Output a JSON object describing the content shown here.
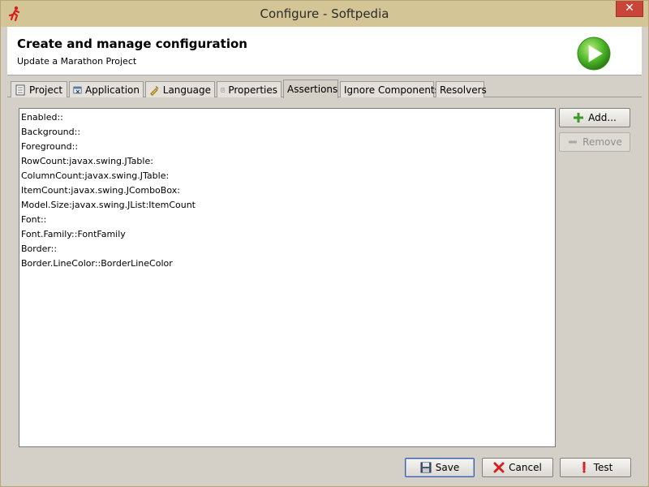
{
  "window": {
    "title": "Configure - Softpedia",
    "close_glyph": "✕"
  },
  "header": {
    "title": "Create and manage configuration",
    "subtitle": "Update a Marathon Project",
    "icon": "green-play-icon"
  },
  "tabs": [
    {
      "label": "Project",
      "icon": "project-icon",
      "active": false
    },
    {
      "label": "Application",
      "icon": "application-icon",
      "active": false
    },
    {
      "label": "Language",
      "icon": "language-icon",
      "active": false
    },
    {
      "label": "Properties",
      "icon": "properties-icon",
      "active": false
    },
    {
      "label": "Assertions",
      "icon": "",
      "active": true
    },
    {
      "label": "Ignore Components",
      "icon": "",
      "active": false
    },
    {
      "label": "Resolvers",
      "icon": "",
      "active": false
    }
  ],
  "assertions": [
    "Enabled::",
    "Background::",
    "Foreground::",
    "RowCount:javax.swing.JTable:",
    "ColumnCount:javax.swing.JTable:",
    "ItemCount:javax.swing.JComboBox:",
    "Model.Size:javax.swing.JList:ItemCount",
    "Font::",
    "Font.Family::FontFamily",
    "Border::",
    "Border.LineColor::BorderLineColor"
  ],
  "side_buttons": {
    "add_label": "Add...",
    "remove_label": "Remove"
  },
  "footer_buttons": {
    "save_label": "Save",
    "cancel_label": "Cancel",
    "test_label": "Test"
  }
}
